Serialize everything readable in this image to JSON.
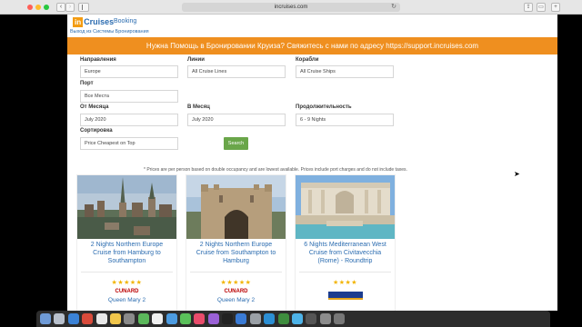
{
  "browser": {
    "url": "incruises.com"
  },
  "header": {
    "logo_in": "in",
    "logo_cruises": "Cruises",
    "booking": "Booking",
    "logout": "Выход из Системы Бронирования"
  },
  "banner": {
    "text": "Нужна Помощь в Бронировании Круиза? Свяжитесь с нами по адресу https://support.incruises.com"
  },
  "form": {
    "destination_label": "Направления",
    "destination_value": "Europe",
    "lines_label": "Линии",
    "lines_value": "All Cruise Lines",
    "ships_label": "Корабли",
    "ships_value": "All Cruise Ships",
    "port_label": "Порт",
    "port_value": "Все Места",
    "from_label": "От Месяца",
    "from_value": "July 2020",
    "to_label": "В Месяц",
    "to_value": "July 2020",
    "duration_label": "Продолжительность",
    "duration_value": "6 - 9 Nights",
    "sort_label": "Сортировка",
    "sort_value": "Price Cheapest on Top",
    "search_label": "Search"
  },
  "note": "* Prices are per person based on double occupancy and are lowest available. Prices include port charges and do not include taxes.",
  "cards": [
    {
      "title": "2 Nights Northern Europe Cruise from Hamburg to Southampton",
      "stars": "★★★★★",
      "brand": "CUNARD",
      "ship": "Queen Mary 2"
    },
    {
      "title": "2 Nights Northern Europe Cruise from Southampton to Hamburg",
      "stars": "★★★★★",
      "brand": "CUNARD",
      "ship": "Queen Mary 2"
    },
    {
      "title": "6 Nights Mediterranean West Cruise from Civitavecchia (Rome) - Roundtrip",
      "stars": "★★★★",
      "brand": "",
      "ship": ""
    }
  ],
  "colors": {
    "banner": "#ef8f1f",
    "link": "#2b6cb0",
    "search": "#6aa64a",
    "star": "#f2b400"
  }
}
